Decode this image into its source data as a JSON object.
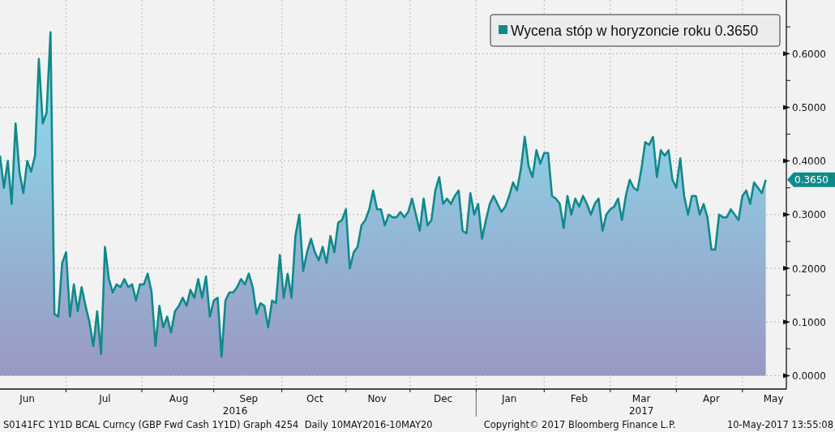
{
  "chart": {
    "chart_data": {
      "type": "area",
      "grid": true,
      "ylim": [
        -0.025,
        0.7
      ],
      "categories": [
        null,
        null,
        null,
        null,
        null,
        null,
        null,
        "Jun",
        null,
        null,
        null,
        null,
        null,
        null,
        null,
        null,
        null,
        null,
        null,
        null,
        null,
        null,
        null,
        null,
        null,
        null,
        null,
        "Jul",
        null,
        null,
        null,
        null,
        null,
        null,
        null,
        null,
        null,
        null,
        null,
        null,
        null,
        null,
        null,
        null,
        null,
        null,
        "Aug",
        null,
        null,
        null,
        null,
        null,
        null,
        null,
        null,
        null,
        null,
        null,
        null,
        null,
        null,
        null,
        null,
        null,
        "Sep",
        null,
        null,
        null,
        null,
        null,
        null,
        null,
        null,
        null,
        null,
        null,
        null,
        null,
        null,
        null,
        null,
        "Oct",
        null,
        null,
        null,
        null,
        null,
        null,
        null,
        null,
        null,
        null,
        null,
        null,
        null,
        null,
        null,
        "Nov",
        null,
        null,
        null,
        null,
        null,
        null,
        null,
        null,
        null,
        null,
        null,
        null,
        null,
        null,
        null,
        null,
        "Dec",
        null,
        null,
        null,
        null,
        null,
        null,
        null,
        null,
        null,
        null,
        null,
        null,
        null,
        null,
        null,
        null,
        "Jan",
        null,
        null,
        null,
        null,
        null,
        null,
        null,
        null,
        null,
        null,
        null,
        null,
        null,
        null,
        null,
        null,
        null,
        "Feb",
        null,
        null,
        null,
        null,
        null,
        null,
        null,
        null,
        null,
        null,
        null,
        null,
        null,
        null,
        null,
        "Mar",
        null,
        null,
        null,
        null,
        null,
        null,
        null,
        null,
        null,
        null,
        null,
        null,
        null,
        null,
        null,
        null,
        null,
        "Apr",
        null,
        null,
        null,
        null,
        null,
        null,
        null,
        null,
        null,
        null,
        null,
        null,
        null,
        null,
        null,
        "May"
      ],
      "yticks": [
        {
          "value": 0,
          "label": "0.0000"
        },
        {
          "value": 0.1,
          "label": "0.1000"
        },
        {
          "value": 0.2,
          "label": "0.2000"
        },
        {
          "value": 0.3,
          "label": "0.3000"
        },
        {
          "value": 0.4,
          "label": "0.4000"
        },
        {
          "value": 0.5,
          "label": "0.5000"
        },
        {
          "value": 0.6,
          "label": "0.6000"
        }
      ],
      "series": [
        {
          "name": "Wycena stóp w horyzoncie roku 0.3650",
          "color": "#0f8a8a",
          "values": [
            0.41,
            0.35,
            0.4,
            0.32,
            0.47,
            0.38,
            0.34,
            0.4,
            0.38,
            0.41,
            0.59,
            0.47,
            0.49,
            0.64,
            0.115,
            0.11,
            0.21,
            0.23,
            0.11,
            0.17,
            0.12,
            0.165,
            0.13,
            0.1,
            0.055,
            0.12,
            0.04,
            0.24,
            0.18,
            0.155,
            0.17,
            0.165,
            0.18,
            0.165,
            0.17,
            0.14,
            0.17,
            0.17,
            0.19,
            0.155,
            0.055,
            0.13,
            0.09,
            0.11,
            0.08,
            0.12,
            0.13,
            0.145,
            0.13,
            0.16,
            0.145,
            0.18,
            0.145,
            0.185,
            0.11,
            0.14,
            0.145,
            0.035,
            0.14,
            0.155,
            0.155,
            0.165,
            0.18,
            0.17,
            0.19,
            0.165,
            0.115,
            0.135,
            0.13,
            0.09,
            0.14,
            0.135,
            0.225,
            0.145,
            0.19,
            0.145,
            0.26,
            0.3,
            0.195,
            0.23,
            0.255,
            0.23,
            0.215,
            0.24,
            0.21,
            0.26,
            0.23,
            0.285,
            0.29,
            0.31,
            0.2,
            0.23,
            0.24,
            0.28,
            0.29,
            0.31,
            0.345,
            0.31,
            0.31,
            0.28,
            0.3,
            0.295,
            0.295,
            0.305,
            0.295,
            0.305,
            0.33,
            0.3,
            0.27,
            0.33,
            0.28,
            0.29,
            0.345,
            0.37,
            0.32,
            0.33,
            0.32,
            0.335,
            0.345,
            0.27,
            0.265,
            0.34,
            0.3,
            0.32,
            0.255,
            0.29,
            0.32,
            0.335,
            0.32,
            0.305,
            0.315,
            0.335,
            0.36,
            0.345,
            0.385,
            0.445,
            0.39,
            0.37,
            0.42,
            0.395,
            0.415,
            0.415,
            0.335,
            0.33,
            0.32,
            0.275,
            0.335,
            0.3,
            0.33,
            0.315,
            0.335,
            0.32,
            0.3,
            0.32,
            0.33,
            0.27,
            0.3,
            0.31,
            0.315,
            0.33,
            0.29,
            0.335,
            0.365,
            0.35,
            0.345,
            0.385,
            0.435,
            0.43,
            0.445,
            0.37,
            0.42,
            0.41,
            0.42,
            0.365,
            0.35,
            0.405,
            0.335,
            0.3,
            0.335,
            0.335,
            0.3,
            0.32,
            0.295,
            0.235,
            0.235,
            0.3,
            0.295,
            0.295,
            0.31,
            0.3,
            0.29,
            0.335,
            0.345,
            0.32,
            0.36,
            0.35,
            0.34,
            0.365,
            null,
            null
          ]
        }
      ],
      "annotations": [
        "0.3650"
      ]
    },
    "year_labels": [
      "2016",
      "2017"
    ]
  },
  "footer": {
    "security": "S0141FC 1Y1D BCAL Curncy (GBP Fwd Cash 1Y1D) Graph 4254  Daily 10MAY2016-10MAY20",
    "copyright": "Copyright© 2017 Bloomberg Finance L.P.",
    "timestamp": "10-May-2017 13:55:08"
  }
}
